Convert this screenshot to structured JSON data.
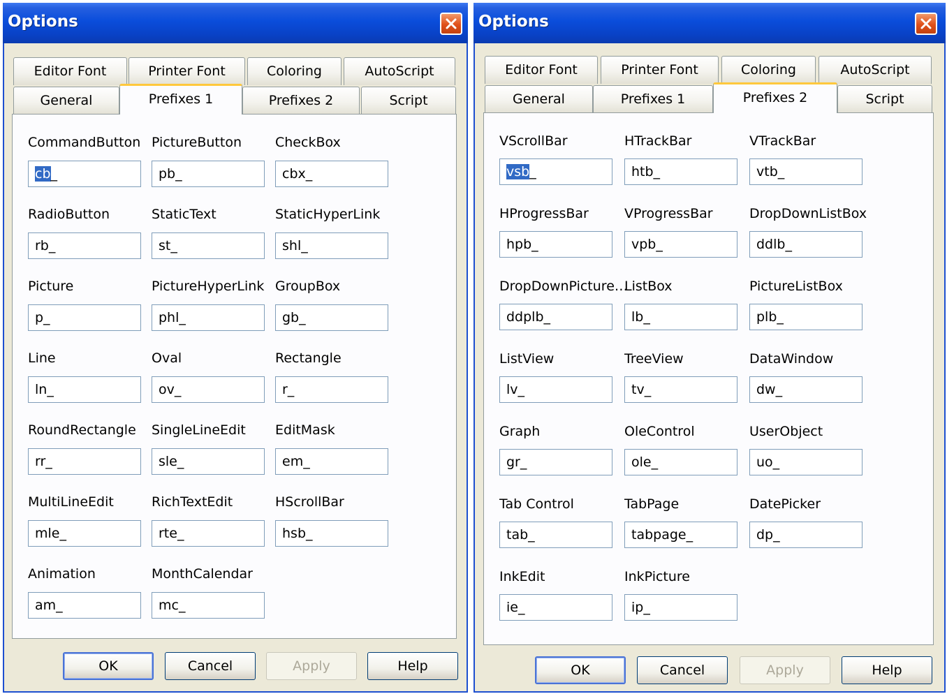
{
  "left": {
    "title": "Options",
    "tabs_row1": [
      "Editor Font",
      "Printer Font",
      "Coloring",
      "AutoScript"
    ],
    "tabs_row2": [
      "General",
      "Prefixes 1",
      "Prefixes 2",
      "Script"
    ],
    "active_tab": "Prefixes 1",
    "fields": [
      {
        "label": "CommandButton",
        "value": "cb_",
        "selected_text": "cb"
      },
      {
        "label": "PictureButton",
        "value": "pb_"
      },
      {
        "label": "CheckBox",
        "value": "cbx_"
      },
      {
        "label": "RadioButton",
        "value": "rb_"
      },
      {
        "label": "StaticText",
        "value": "st_"
      },
      {
        "label": "StaticHyperLink",
        "value": "shl_"
      },
      {
        "label": "Picture",
        "value": "p_"
      },
      {
        "label": "PictureHyperLink",
        "value": "phl_"
      },
      {
        "label": "GroupBox",
        "value": "gb_"
      },
      {
        "label": "Line",
        "value": "ln_"
      },
      {
        "label": "Oval",
        "value": "ov_"
      },
      {
        "label": "Rectangle",
        "value": "r_"
      },
      {
        "label": "RoundRectangle",
        "value": "rr_"
      },
      {
        "label": "SingleLineEdit",
        "value": "sle_"
      },
      {
        "label": "EditMask",
        "value": "em_"
      },
      {
        "label": "MultiLineEdit",
        "value": "mle_"
      },
      {
        "label": "RichTextEdit",
        "value": "rte_"
      },
      {
        "label": "HScrollBar",
        "value": "hsb_"
      },
      {
        "label": "Animation",
        "value": "am_"
      },
      {
        "label": "MonthCalendar",
        "value": "mc_"
      }
    ],
    "buttons": {
      "ok": "OK",
      "cancel": "Cancel",
      "apply": "Apply",
      "help": "Help"
    }
  },
  "right": {
    "title": "Options",
    "tabs_row1": [
      "Editor Font",
      "Printer Font",
      "Coloring",
      "AutoScript"
    ],
    "tabs_row2": [
      "General",
      "Prefixes 1",
      "Prefixes 2",
      "Script"
    ],
    "active_tab": "Prefixes 2",
    "fields": [
      {
        "label": "VScrollBar",
        "value": "vsb_",
        "selected_text": "vsb"
      },
      {
        "label": "HTrackBar",
        "value": "htb_"
      },
      {
        "label": "VTrackBar",
        "value": "vtb_"
      },
      {
        "label": "HProgressBar",
        "value": "hpb_"
      },
      {
        "label": "VProgressBar",
        "value": "vpb_"
      },
      {
        "label": "DropDownListBox",
        "value": "ddlb_"
      },
      {
        "label": "DropDownPicture…",
        "value": "ddplb_"
      },
      {
        "label": "ListBox",
        "value": "lb_"
      },
      {
        "label": "PictureListBox",
        "value": "plb_"
      },
      {
        "label": "ListView",
        "value": "lv_"
      },
      {
        "label": "TreeView",
        "value": "tv_"
      },
      {
        "label": "DataWindow",
        "value": "dw_"
      },
      {
        "label": "Graph",
        "value": "gr_"
      },
      {
        "label": "OleControl",
        "value": "ole_"
      },
      {
        "label": "UserObject",
        "value": "uo_"
      },
      {
        "label": "Tab Control",
        "value": "tab_"
      },
      {
        "label": "TabPage",
        "value": "tabpage_"
      },
      {
        "label": "DatePicker",
        "value": "dp_"
      },
      {
        "label": "InkEdit",
        "value": "ie_"
      },
      {
        "label": "InkPicture",
        "value": "ip_"
      }
    ],
    "buttons": {
      "ok": "OK",
      "cancel": "Cancel",
      "apply": "Apply",
      "help": "Help"
    }
  },
  "colors": {
    "titlebar": "#0a4ddb",
    "dialog_bg": "#ece9d8",
    "panel_bg": "#fcfcfe",
    "active_tab_accent": "#ffc83c",
    "close_button": "#e0501a",
    "selection": "#316ac5"
  },
  "icons": {
    "close": "close-icon"
  }
}
